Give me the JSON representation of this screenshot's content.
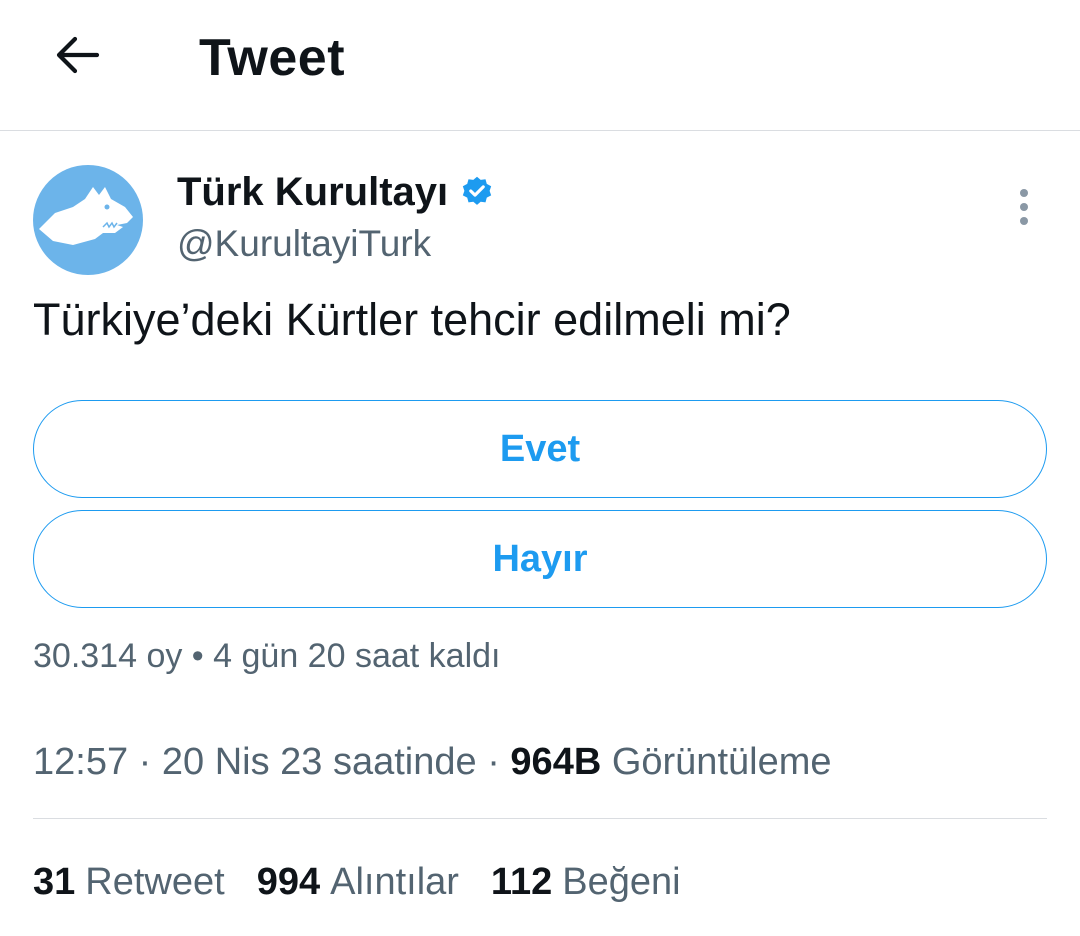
{
  "header": {
    "title": "Tweet",
    "back_icon": "arrow-left-icon"
  },
  "author": {
    "display_name": "Türk Kurultayı",
    "handle": "@KurultayiTurk",
    "verified": true,
    "avatar_color": "#6cb4ea",
    "badge_color": "#1d9bf0"
  },
  "more_icon": "more-vertical-icon",
  "tweet": {
    "text": "Türkiye’deki Kürtler tehcir edilmeli mi?"
  },
  "poll": {
    "options": [
      {
        "label": "Evet"
      },
      {
        "label": "Hayır"
      }
    ],
    "votes": "30.314 oy",
    "separator": " • ",
    "time_left": "4 gün 20 saat kaldı"
  },
  "meta": {
    "time": "12:57",
    "sep1": " · ",
    "date": "20 Nis 23 saatinde",
    "sep2": " · ",
    "views_count": "964B",
    "views_label": "Görüntüleme"
  },
  "stats": {
    "retweets_count": "31",
    "retweets_label": "Retweet",
    "quotes_count": "994",
    "quotes_label": "Alıntılar",
    "likes_count": "112",
    "likes_label": "Beğeni"
  },
  "colors": {
    "accent": "#1d9bf0",
    "text": "#0f1419",
    "secondary": "#536471",
    "divider": "#dadde1"
  }
}
